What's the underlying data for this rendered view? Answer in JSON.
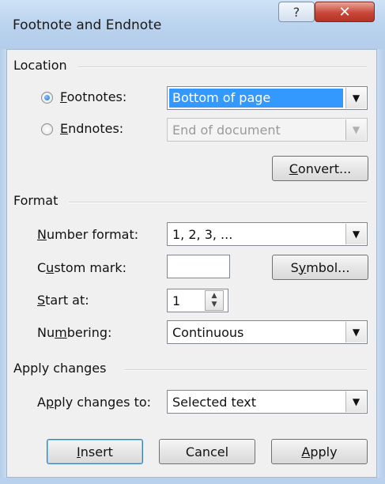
{
  "window": {
    "title": "Footnote and Endnote",
    "help_label": "?",
    "close_label": "✕"
  },
  "location": {
    "heading": "Location",
    "footnotes": {
      "label_first": "F",
      "label_rest": "ootnotes:",
      "selected": true,
      "value": "Bottom of page"
    },
    "endnotes": {
      "label_first": "E",
      "label_rest": "ndnotes:",
      "selected": false,
      "value": "End of document"
    },
    "convert_button": {
      "first": "C",
      "rest": "onvert..."
    }
  },
  "format": {
    "heading": "Format",
    "number_format": {
      "label_first": "N",
      "label_rest": "umber format:",
      "value": "1, 2, 3, ..."
    },
    "custom_mark": {
      "label_pre": "C",
      "label_u": "u",
      "label_rest": "stom mark:",
      "value": ""
    },
    "symbol_button": {
      "pre": "S",
      "u": "y",
      "rest": "mbol..."
    },
    "start_at": {
      "label_first": "S",
      "label_rest": "tart at:",
      "value": "1"
    },
    "numbering": {
      "label_pre": "Nu",
      "label_u": "m",
      "label_rest": "bering:",
      "value": "Continuous"
    }
  },
  "apply_changes": {
    "heading": "Apply changes",
    "apply_to": {
      "label_pre": "A",
      "label_u": "p",
      "label_rest": "ply changes to:",
      "value": "Selected text"
    }
  },
  "buttons": {
    "insert": {
      "first": "I",
      "rest": "nsert"
    },
    "cancel": "Cancel",
    "apply": {
      "first": "A",
      "rest": "pply"
    }
  },
  "colors": {
    "selection": "#3399ff",
    "titlebar": "#b9d2ee",
    "close": "#c9473a"
  }
}
